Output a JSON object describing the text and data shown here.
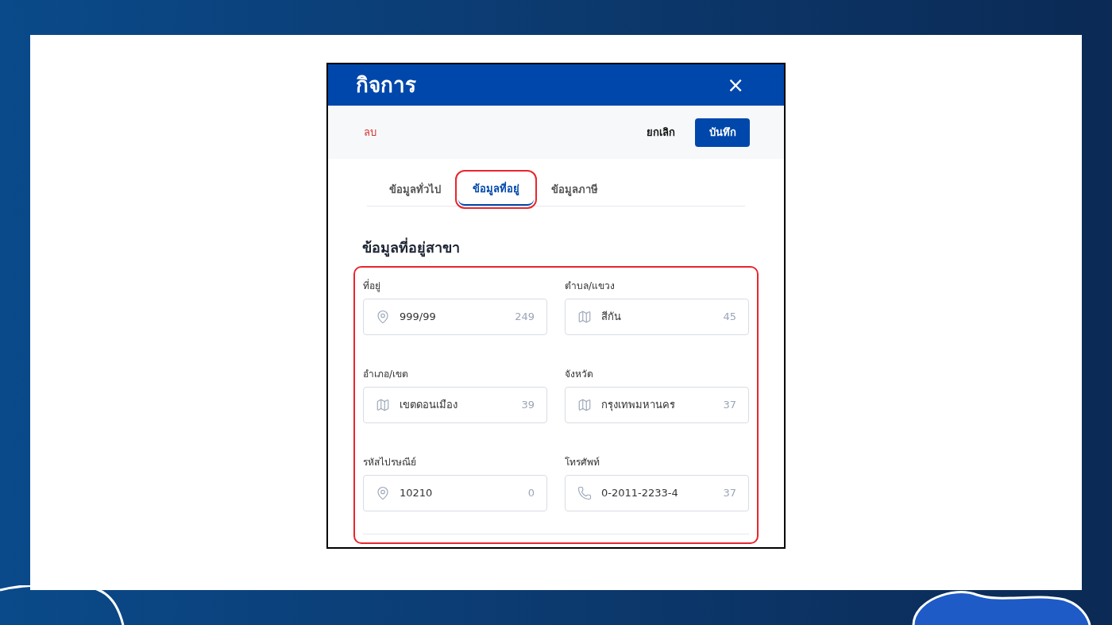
{
  "dialog": {
    "title": "กิจการ",
    "close": "×"
  },
  "toolbar": {
    "delete": "ลบ",
    "cancel": "ยกเลิก",
    "save": "บันทึก"
  },
  "tabs": [
    {
      "label": "ข้อมูลทั่วไป",
      "selected": false,
      "highlighted": false
    },
    {
      "label": "ข้อมูลที่อยู่",
      "selected": true,
      "highlighted": true
    },
    {
      "label": "ข้อมูลภาษี",
      "selected": false,
      "highlighted": false
    }
  ],
  "section": {
    "title": "ข้อมูลที่อยู่สาขา",
    "highlighted": true,
    "fields": [
      {
        "label": "ที่อยู่",
        "kind": "pin",
        "value": "999/99",
        "count": "249"
      },
      {
        "label": "ตำบล/แขวง",
        "kind": "map",
        "value": "สีกัน",
        "count": "45"
      },
      {
        "label": "อำเภอ/เขต",
        "kind": "map",
        "value": "เขตดอนเมือง",
        "count": "39"
      },
      {
        "label": "จังหวัด",
        "kind": "map",
        "value": "กรุงเทพมหานคร",
        "count": "37"
      },
      {
        "label": "รหัสไปรษณีย์",
        "kind": "pin",
        "value": "10210",
        "count": "0"
      },
      {
        "label": "โทรศัพท์",
        "kind": "phone",
        "value": "0-2011-2233-4",
        "count": "37"
      }
    ]
  }
}
